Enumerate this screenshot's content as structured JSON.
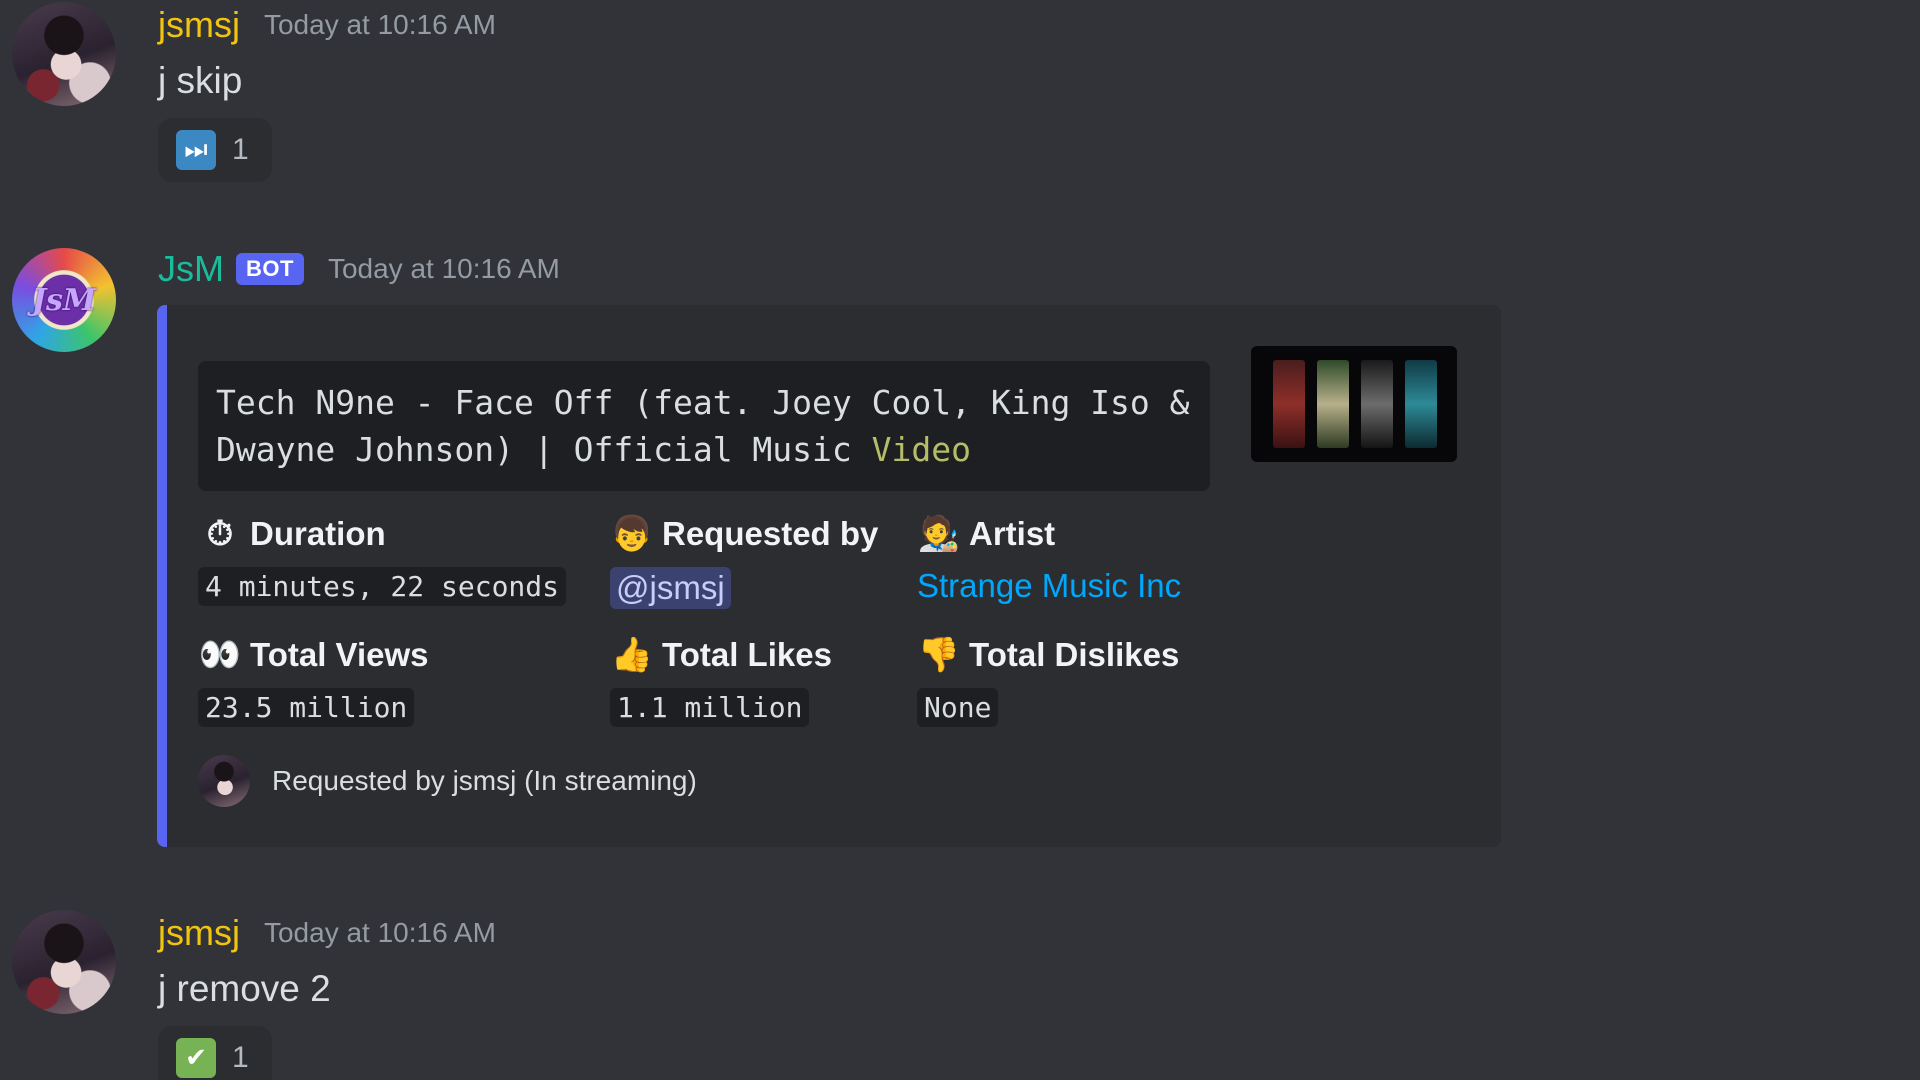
{
  "messages": [
    {
      "username": "jsmsj",
      "timestamp": "Today at 10:16 AM",
      "content": "j skip",
      "reaction": {
        "icon": "next-track-icon",
        "glyph": "⏭",
        "count": "1"
      }
    },
    {
      "username": "JsM",
      "bot_tag": "BOT",
      "timestamp": "Today at 10:16 AM",
      "embed": {
        "accent_color": "#5865f2",
        "title_line1": "Tech N9ne - Face Off (feat. Joey Cool, King Iso &",
        "title_line2_main": "Dwayne Johnson) | Official Music ",
        "title_line2_accent": "Video",
        "fields": {
          "duration": {
            "icon": "stopwatch-icon",
            "glyph": "⏱",
            "title": "Duration",
            "value": "4 minutes, 22 seconds"
          },
          "requested_by": {
            "icon": "person-icon",
            "glyph": "👦",
            "title": "Requested by",
            "value": "@jsmsj"
          },
          "artist": {
            "icon": "artist-icon",
            "glyph": "🧑‍🎨",
            "title": "Artist",
            "value": "Strange Music Inc"
          },
          "views": {
            "icon": "eyes-icon",
            "glyph": "👀",
            "title": "Total Views",
            "value": "23.5 million"
          },
          "likes": {
            "icon": "thumbs-up-icon",
            "glyph": "👍",
            "title": "Total Likes",
            "value": "1.1 million"
          },
          "dislikes": {
            "icon": "thumbs-down-icon",
            "glyph": "👎",
            "title": "Total Dislikes",
            "value": "None"
          }
        },
        "footer": "Requested by jsmsj (In streaming)"
      }
    },
    {
      "username": "jsmsj",
      "timestamp": "Today at 10:16 AM",
      "content": "j remove 2",
      "reaction": {
        "icon": "check-mark-icon",
        "glyph": "✔",
        "count": "1"
      }
    }
  ],
  "colors": {
    "background": "#313338",
    "username_user": "#f1c40f",
    "username_bot": "#1abc9c",
    "link": "#00a8fc",
    "bot_tag": "#5865f2"
  }
}
